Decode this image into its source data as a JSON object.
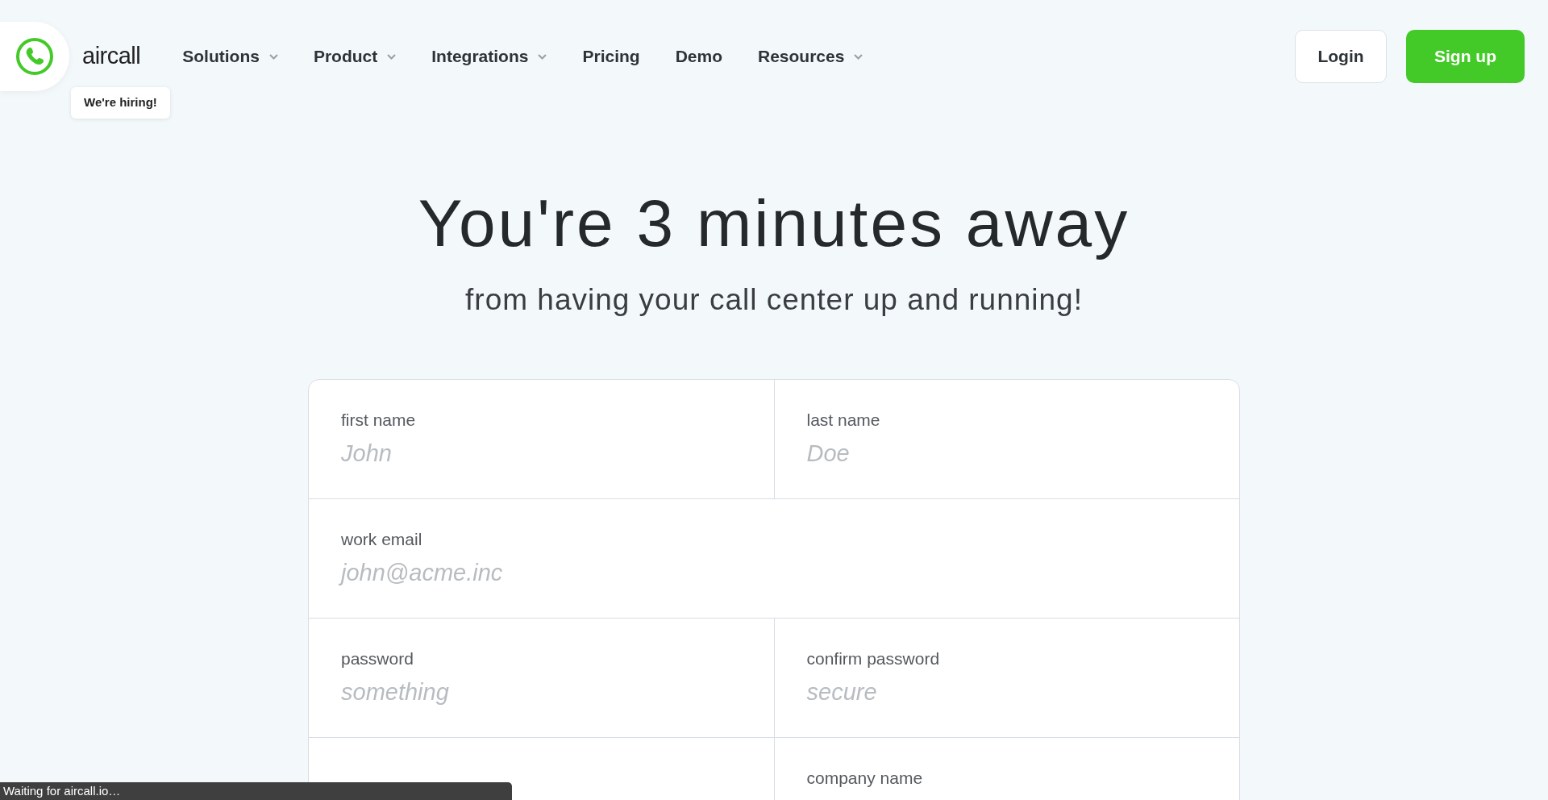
{
  "logo": {
    "text": "aircall"
  },
  "hiring_tooltip": "We're hiring!",
  "nav": [
    {
      "label": "Solutions",
      "dropdown": true
    },
    {
      "label": "Product",
      "dropdown": true
    },
    {
      "label": "Integrations",
      "dropdown": true
    },
    {
      "label": "Pricing",
      "dropdown": false
    },
    {
      "label": "Demo",
      "dropdown": false
    },
    {
      "label": "Resources",
      "dropdown": true
    }
  ],
  "actions": {
    "login": "Login",
    "signup": "Sign up"
  },
  "heading": "You're 3 minutes away",
  "subheading": "from having your call center up and running!",
  "form": {
    "rows": [
      [
        {
          "label": "first name",
          "placeholder": "John"
        },
        {
          "label": "last name",
          "placeholder": "Doe"
        }
      ],
      [
        {
          "label": "work email",
          "placeholder": "john@acme.inc"
        }
      ],
      [
        {
          "label": "password",
          "placeholder": "something"
        },
        {
          "label": "confirm password",
          "placeholder": "secure"
        }
      ],
      [
        {},
        {
          "label": "company name"
        }
      ]
    ]
  },
  "status_bar": "Waiting for aircall.io…"
}
